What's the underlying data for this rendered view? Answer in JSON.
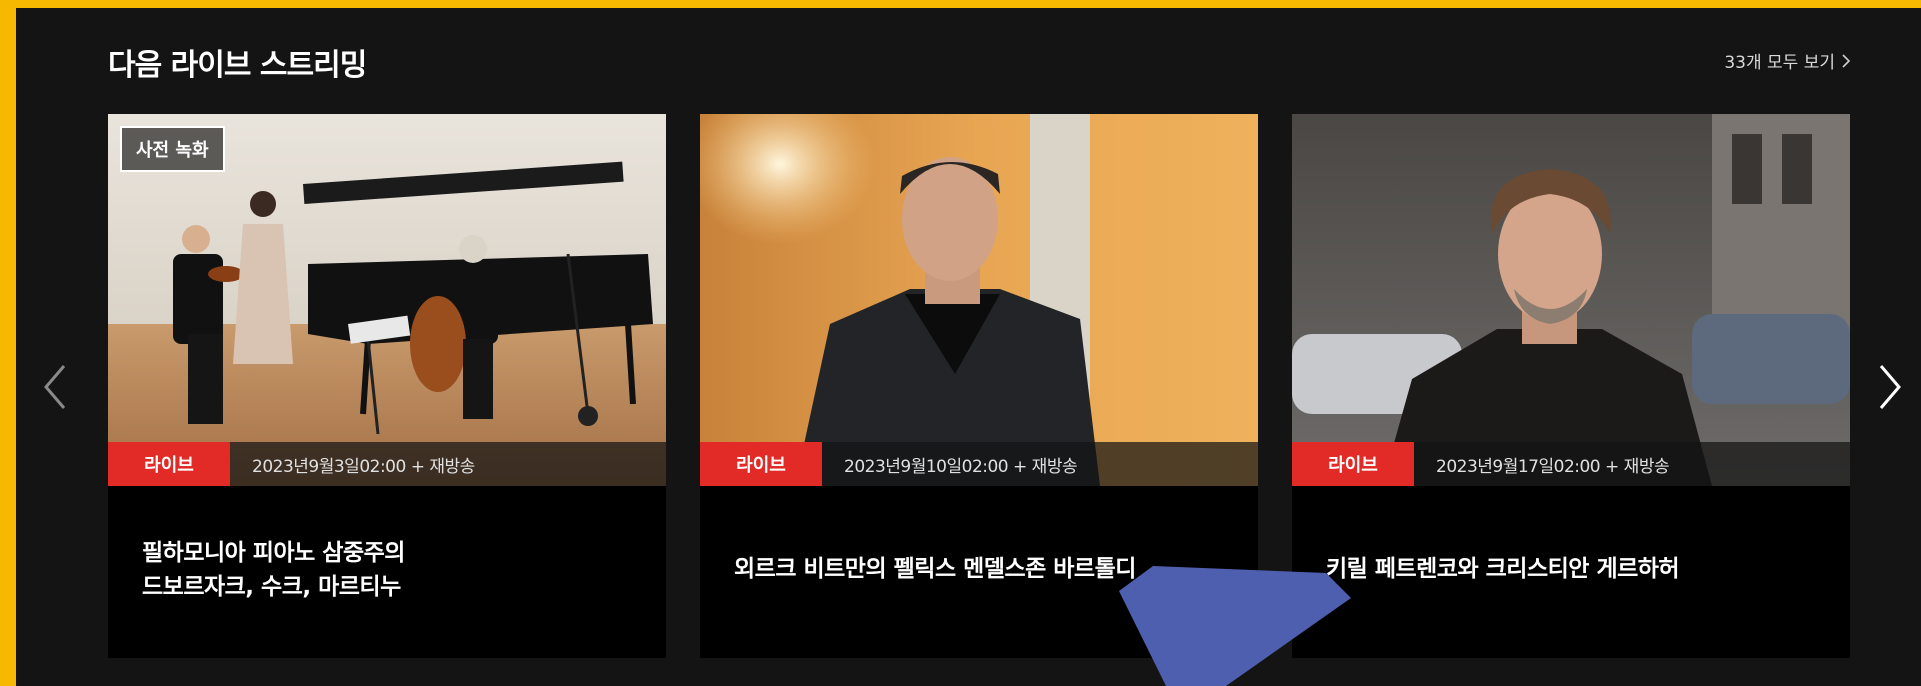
{
  "section": {
    "title": "다음 라이브 스트리밍",
    "see_all_label": "33개 모두 보기"
  },
  "cards": [
    {
      "badge": "사전 녹화",
      "live_label": "라이브",
      "datetime": "2023년9월3일02:00 + 재방송",
      "title_lines": [
        "필하모니아 피아노 삼중주의",
        "드보르자크, 수크, 마르티누"
      ]
    },
    {
      "live_label": "라이브",
      "datetime": "2023년9월10일02:00 + 재방송",
      "title_lines": [
        "외르크 비트만의 펠릭스 멘델스존 바르톨디"
      ]
    },
    {
      "live_label": "라이브",
      "datetime": "2023년9월17일02:00 + 재방송",
      "title_lines": [
        "키릴 페트렌코와 크리스티안 게르하허"
      ]
    }
  ],
  "colors": {
    "frame_border": "#f6b800",
    "background": "#141414",
    "live_badge": "#e22b26",
    "checkmark": "#4f5fb0"
  },
  "icons": {
    "prev": "chevron-left-icon",
    "next": "chevron-right-icon",
    "see_all": "chevron-right-icon"
  }
}
